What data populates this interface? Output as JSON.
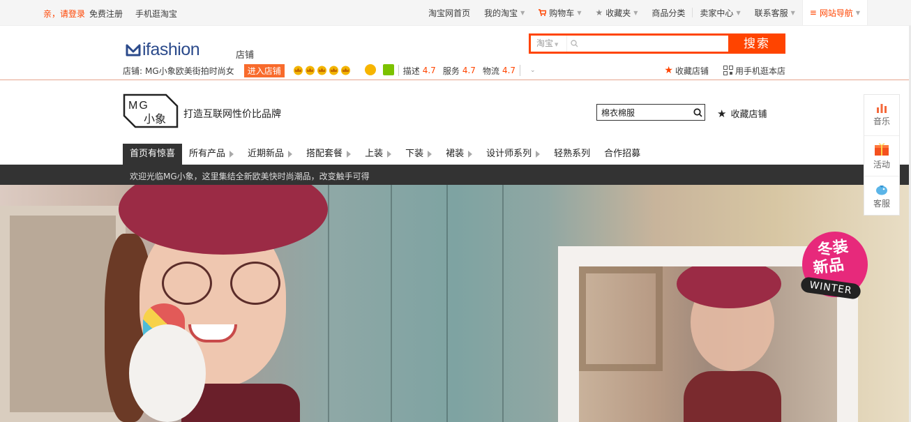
{
  "topbar": {
    "login": "亲，请登录",
    "register": "免费注册",
    "mobile": "手机逛淘宝",
    "links": [
      {
        "label": "淘宝网首页",
        "dropdown": false
      },
      {
        "label": "我的淘宝",
        "dropdown": true
      },
      {
        "label": "购物车",
        "dropdown": true
      },
      {
        "label": "收藏夹",
        "dropdown": true
      },
      {
        "label": "商品分类",
        "dropdown": false
      },
      {
        "label": "卖家中心",
        "dropdown": true
      },
      {
        "label": "联系客服",
        "dropdown": true
      },
      {
        "label": "网站导航",
        "dropdown": true
      }
    ]
  },
  "header": {
    "logo": "ifashion",
    "shop_word": "店铺",
    "search_scope": "淘宝",
    "search_value": "",
    "search_button": "搜索",
    "shop_label": "店铺:",
    "shop_name": "MG小象欧美街拍时尚女",
    "enter_shop": "进入店铺",
    "ratings": [
      {
        "label": "描述",
        "value": "4.7"
      },
      {
        "label": "服务",
        "value": "4.7"
      },
      {
        "label": "物流",
        "value": "4.7"
      }
    ],
    "favorite_shop": "收藏店铺",
    "mobile_shop": "用手机逛本店"
  },
  "shop": {
    "logo_top": "MG",
    "logo_bottom": "小象",
    "slogan": "打造互联网性价比品牌",
    "search_value": "棉衣棉服",
    "favorite": "收藏店铺"
  },
  "nav": [
    {
      "label": "首页有惊喜",
      "arrow": false,
      "active": true
    },
    {
      "label": "所有产品",
      "arrow": true
    },
    {
      "label": "近期新品",
      "arrow": true
    },
    {
      "label": "搭配套餐",
      "arrow": true
    },
    {
      "label": "上装",
      "arrow": true
    },
    {
      "label": "下装",
      "arrow": true
    },
    {
      "label": "裙装",
      "arrow": true
    },
    {
      "label": "设计师系列",
      "arrow": true
    },
    {
      "label": "轻熟系列",
      "arrow": false
    },
    {
      "label": "合作招募",
      "arrow": false
    }
  ],
  "welcome": "欢迎光临MG小象，这里集结全新欧美快时尚潮品，改变触手可得",
  "hero": {
    "tag_line1": "冬装",
    "tag_line2": "新品",
    "tag_en": "WINTER"
  },
  "float_panel": [
    {
      "label": "音乐",
      "icon": "music-bars-icon"
    },
    {
      "label": "活动",
      "icon": "gift-sale-icon"
    },
    {
      "label": "客服",
      "icon": "service-fish-icon"
    }
  ],
  "colors": {
    "accent": "#ff4400",
    "brand_blue": "#2b4a8b",
    "nav_dark": "#333333",
    "tag_pink": "#e7297b"
  }
}
